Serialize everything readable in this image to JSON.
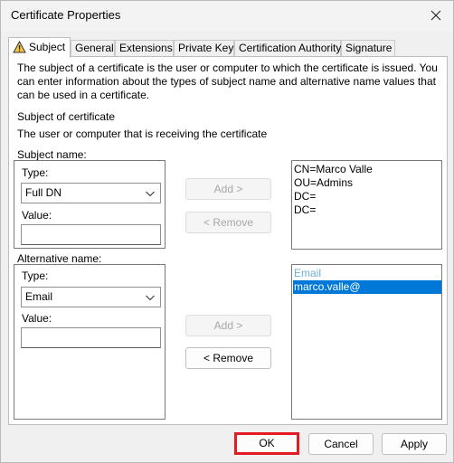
{
  "window": {
    "title": "Certificate Properties"
  },
  "tabs": [
    {
      "label": "Subject",
      "active": true,
      "icon": "warning-icon"
    },
    {
      "label": "General"
    },
    {
      "label": "Extensions"
    },
    {
      "label": "Private Key"
    },
    {
      "label": "Certification Authority"
    },
    {
      "label": "Signature"
    }
  ],
  "subject_tab": {
    "intro": "The subject of a certificate is the user or computer to which the certificate is issued. You can enter information about the types of subject name and alternative name values that can be used in a certificate.",
    "subject_of_certificate": "Subject of certificate",
    "subject_description": "The user or computer that is receiving the certificate",
    "subject_name": {
      "group_label": "Subject name:",
      "type_label": "Type:",
      "type_value": "Full DN",
      "value_label": "Value:",
      "value": "",
      "add_button": "Add >",
      "remove_button": "< Remove",
      "entries": [
        "CN=Marco Valle",
        "OU=Admins",
        "DC=",
        "DC="
      ]
    },
    "alternative_name": {
      "group_label": "Alternative name:",
      "type_label": "Type:",
      "type_value": "Email",
      "value_label": "Value:",
      "value": "",
      "add_button": "Add >",
      "remove_button": "< Remove",
      "entry_header": "Email",
      "entries": [
        "marco.valle@"
      ]
    }
  },
  "footer": {
    "ok": "OK",
    "cancel": "Cancel",
    "apply": "Apply"
  },
  "colors": {
    "selection": "#0078d7",
    "highlight_box": "#e31b23",
    "placeholder_text": "#6fb0d8"
  }
}
